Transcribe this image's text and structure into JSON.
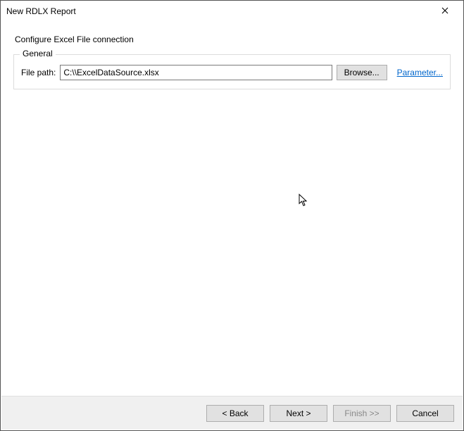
{
  "window": {
    "title": "New RDLX Report"
  },
  "page": {
    "heading": "Configure Excel File connection"
  },
  "general": {
    "legend": "General",
    "file_path_label": "File path:",
    "file_path_value": "C:\\\\ExcelDataSource.xlsx",
    "browse_label": "Browse...",
    "parameter_link": "Parameter..."
  },
  "footer": {
    "back": "< Back",
    "next": "Next >",
    "finish": "Finish >>",
    "cancel": "Cancel"
  }
}
